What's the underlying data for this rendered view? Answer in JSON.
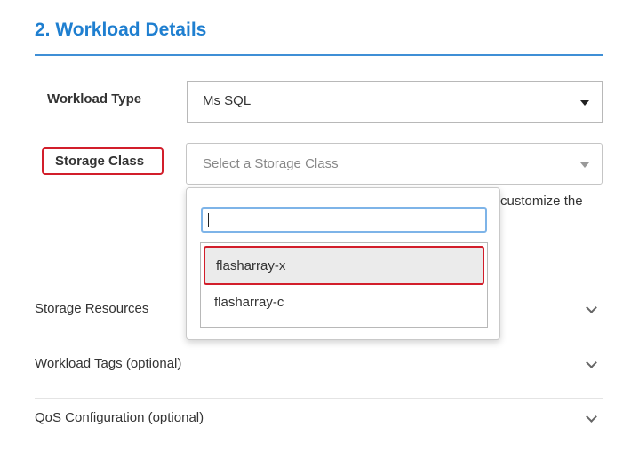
{
  "section": {
    "title": "2. Workload Details"
  },
  "workload_type": {
    "label": "Workload Type",
    "value": "Ms SQL"
  },
  "storage_class": {
    "label": "Storage Class",
    "placeholder": "Select a Storage Class",
    "search_value": "",
    "options": [
      {
        "label": "flasharray-x"
      },
      {
        "label": "flasharray-c"
      }
    ]
  },
  "help_text": "customize the",
  "accordions": [
    {
      "label": "Storage Resources"
    },
    {
      "label": "Workload Tags (optional)"
    },
    {
      "label": "QoS Configuration (optional)"
    }
  ],
  "icons": {
    "select_caret": "caret-down-icon",
    "accordion_chevron": "chevron-down-icon"
  },
  "colors": {
    "accent": "#1f7fd0",
    "highlight_border": "#d21e2b",
    "search_focus": "#7eb4e8"
  }
}
